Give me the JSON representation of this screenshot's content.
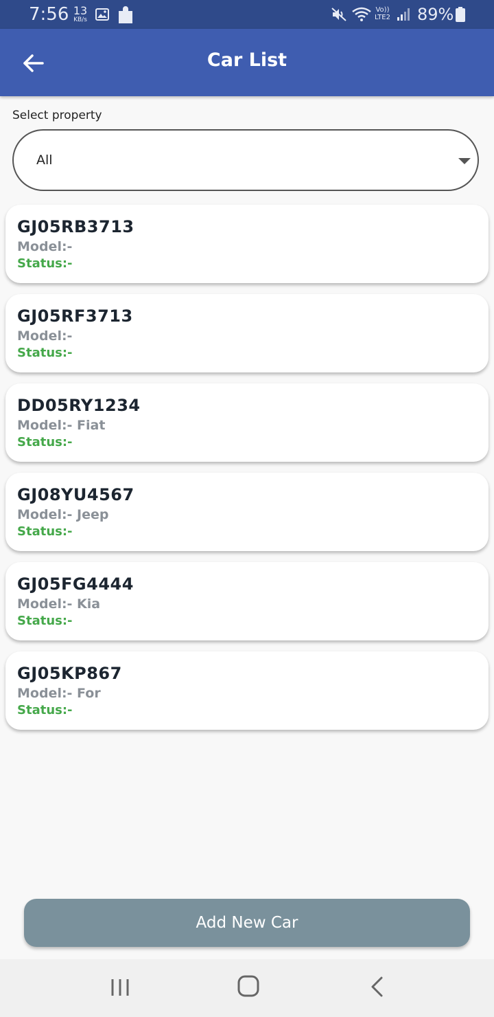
{
  "status_bar": {
    "time": "7:56",
    "speed_value": "13",
    "speed_unit": "KB/s",
    "lte_top": "Vo))",
    "lte_bottom": "LTE2",
    "battery": "89%"
  },
  "app_bar": {
    "title": "Car List",
    "back_icon": "arrow-left-icon"
  },
  "filter": {
    "label": "Select property",
    "selected": "All"
  },
  "cars": [
    {
      "plate": "GJ05RB3713",
      "model": "Model:-",
      "status": "Status:-"
    },
    {
      "plate": "GJ05RF3713",
      "model": "Model:-",
      "status": "Status:-"
    },
    {
      "plate": "DD05RY1234",
      "model": "Model:- Fiat",
      "status": "Status:-"
    },
    {
      "plate": "GJ08YU4567",
      "model": "Model:- Jeep",
      "status": "Status:-"
    },
    {
      "plate": "GJ05FG4444",
      "model": "Model:- Kia",
      "status": "Status:-"
    },
    {
      "plate": "GJ05KP867",
      "model": "Model:- For",
      "status": "Status:-"
    }
  ],
  "add_button": {
    "label": "Add New Car"
  },
  "colors": {
    "status_bar": "#2f4a8a",
    "app_bar": "#3f5db0",
    "status_text": "#45a84a",
    "add_button": "#7a919c"
  }
}
